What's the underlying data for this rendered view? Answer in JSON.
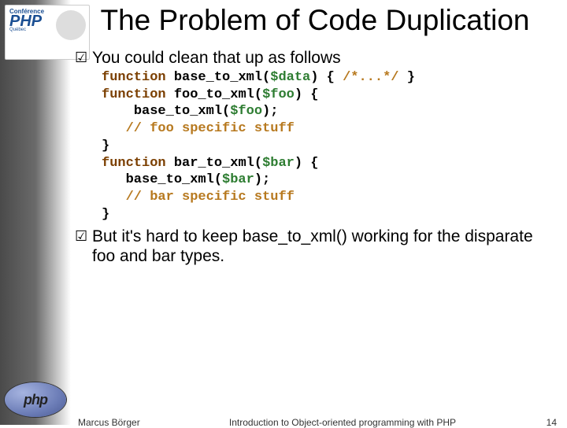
{
  "logo": {
    "line1": "Conférence",
    "line2": "PHP",
    "line3": "Québec"
  },
  "phpLogo": "php",
  "title": "The Problem of Code Duplication",
  "bullets": {
    "b1": "You could clean that up as follows",
    "b2": "But it's hard to keep base_to_xml() working for the disparate foo and bar types."
  },
  "checkmark": "☑",
  "code": {
    "l1": {
      "kw": "function ",
      "fn": "base_to_xml",
      "p1": "(",
      "var": "$data",
      "p2": ") { ",
      "cmt": "/*...*/",
      "p3": " }"
    },
    "l2": {
      "kw": "function ",
      "fn": "foo_to_xml",
      "p1": "(",
      "var": "$foo",
      "p2": ") {"
    },
    "l3": {
      "indent": "    ",
      "fn": "base_to_xml",
      "p1": "(",
      "var": "$foo",
      "p2": ");"
    },
    "l4": {
      "indent": "   ",
      "cmt": "// foo specific stuff"
    },
    "l5": {
      "text": "}"
    },
    "l6": {
      "kw": "function ",
      "fn": "bar_to_xml",
      "p1": "(",
      "var": "$bar",
      "p2": ") {"
    },
    "l7": {
      "indent": "   ",
      "fn": "base_to_xml",
      "p1": "(",
      "var": "$bar",
      "p2": ");"
    },
    "l8": {
      "indent": "   ",
      "cmt": "// bar specific stuff"
    },
    "l9": {
      "text": "}"
    }
  },
  "footer": {
    "author": "Marcus Börger",
    "mid": "Introduction to Object-oriented programming with PHP",
    "page": "14"
  }
}
